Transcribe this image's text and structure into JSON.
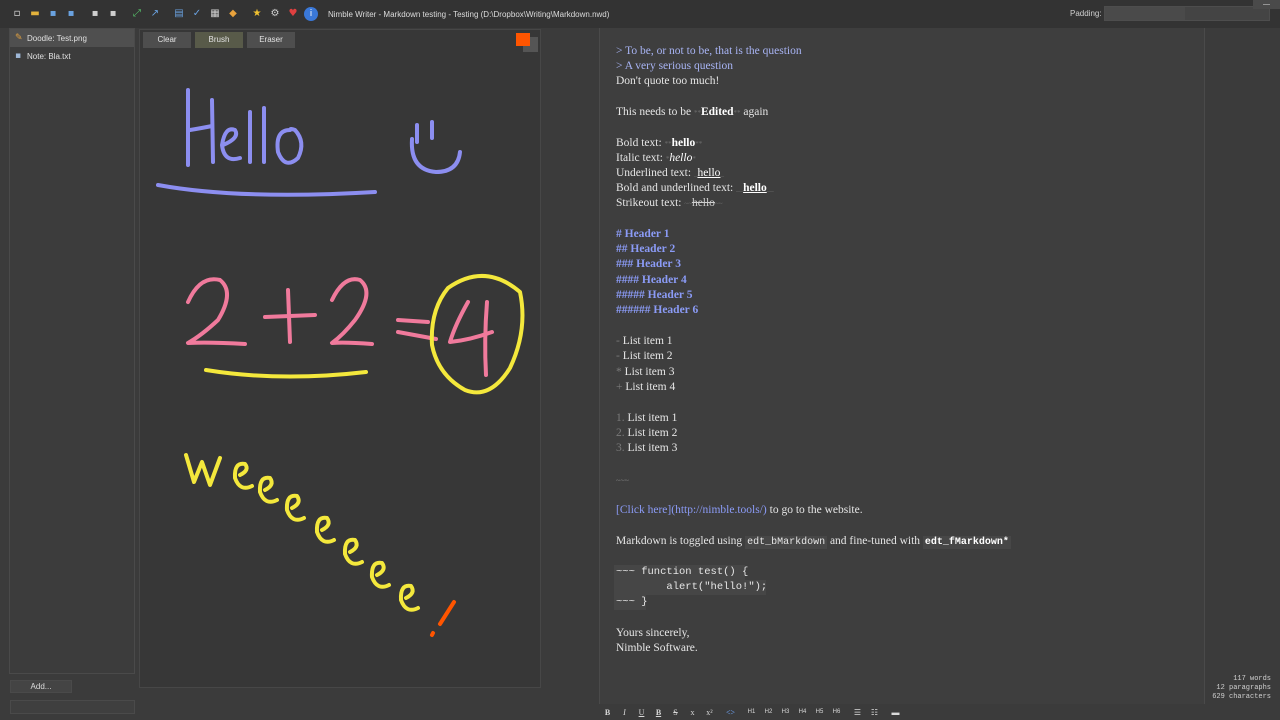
{
  "window": {
    "title": "Nimble Writer - Markdown testing - Testing (D:\\Dropbox\\Writing\\Markdown.nwd)",
    "padding_label": "Padding:"
  },
  "toolbar_icons": [
    {
      "name": "new-file-icon",
      "glyph": "▫",
      "color": "#e8e8e8"
    },
    {
      "name": "open-folder-icon",
      "glyph": "▬",
      "color": "#e3b23c"
    },
    {
      "name": "save-icon",
      "glyph": "▪",
      "color": "#6aa2e0"
    },
    {
      "name": "save-all-icon",
      "glyph": "▪",
      "color": "#6aa2e0"
    },
    {
      "name": "add-document-icon",
      "glyph": "▪",
      "color": "#cfcfcf"
    },
    {
      "name": "remove-document-icon",
      "glyph": "▪",
      "color": "#cfcfcf"
    },
    {
      "name": "fullscreen-icon",
      "glyph": "⤢",
      "color": "#57c26a"
    },
    {
      "name": "sort-icon",
      "glyph": "↗",
      "color": "#6aa2e0"
    },
    {
      "name": "book-icon",
      "glyph": "▤",
      "color": "#6aa2e0"
    },
    {
      "name": "spellcheck-icon",
      "glyph": "✓",
      "color": "#6aa2e0"
    },
    {
      "name": "document-properties-icon",
      "glyph": "▦",
      "color": "#d0d0d0"
    },
    {
      "name": "tag-icon",
      "glyph": "◆",
      "color": "#e8a23c"
    },
    {
      "name": "star-icon",
      "glyph": "★",
      "color": "#f2c230"
    },
    {
      "name": "settings-gear-icon",
      "glyph": "⚙",
      "color": "#d0d0d0"
    },
    {
      "name": "heart-icon",
      "glyph": "♥",
      "color": "#e04040"
    },
    {
      "name": "info-icon",
      "glyph": "i",
      "color": "#ffffff"
    }
  ],
  "files": [
    {
      "label": "Doodle: Test.png",
      "icon": "brush-icon",
      "selected": true
    },
    {
      "label": "Note: Bla.txt",
      "icon": "note-icon",
      "selected": false
    }
  ],
  "add_button": "Add...",
  "doodle": {
    "buttons": [
      "Clear",
      "Brush",
      "Eraser"
    ],
    "active_button": "Brush",
    "current_color": "#ff5500",
    "stroke_colors": {
      "hello": "#8c8ef0",
      "math": "#f07a9c",
      "answer": "#f4e83c",
      "exclaim": "#ff5500"
    }
  },
  "editor": {
    "quote1": "> To be, or not to be, that is the question",
    "quote2": "> A very serious question",
    "plain1": "Don't quote too much!",
    "edited_pre": "This needs to be ",
    "edited_mark": "**",
    "edited_word": "Edited",
    "edited_post": " again",
    "bold_label": "Bold text: ",
    "bold_mark": "**",
    "hello": "hello",
    "italic_label": "Italic text: ",
    "italic_mark": "*",
    "underline_label": "Underlined text: ",
    "underline_mark": "_",
    "boldunder_label": "Bold and underlined text: ",
    "boldunder_mark": "__",
    "strike_label": "Strikeout text: ",
    "strike_mark": "~~",
    "headers": [
      "# Header 1",
      "## Header 2",
      "### Header 3",
      "#### Header 4",
      "##### Header 5",
      "###### Header 6"
    ],
    "bullets": [
      {
        "mark": "-",
        "text": "List item 1"
      },
      {
        "mark": "-",
        "text": "List item 2"
      },
      {
        "mark": "*",
        "text": "List item 3"
      },
      {
        "mark": "+",
        "text": "List item 4"
      }
    ],
    "numbered": [
      {
        "mark": "1.",
        "text": "List item 1"
      },
      {
        "mark": "2.",
        "text": "List item 2"
      },
      {
        "mark": "3.",
        "text": "List item 3"
      }
    ],
    "hr": "~~~",
    "link_text": "[Click here](http://nimble.tools/)",
    "link_after": " to go to the website.",
    "toggle_pre": "Markdown is toggled using ",
    "toggle_code1": "edt_bMarkdown",
    "toggle_mid": " and fine-tuned with ",
    "toggle_code2": "edt_fMarkdown*",
    "code_lines": [
      "~~~ function test() {",
      "        alert(\"hello!\");",
      "~~~ }"
    ],
    "closing1": "Yours sincerely,",
    "closing2": "Nimble Software."
  },
  "stats": {
    "words": "117 words",
    "paragraphs": "12 paragraphs",
    "characters": "629 characters"
  },
  "format_buttons": [
    {
      "name": "bold-button",
      "label": "B"
    },
    {
      "name": "italic-button",
      "label": "I"
    },
    {
      "name": "underline-button",
      "label": "U"
    },
    {
      "name": "bold-underline-button",
      "label": "B"
    },
    {
      "name": "strikeout-button",
      "label": "S"
    },
    {
      "name": "subscript-button",
      "label": "x"
    },
    {
      "name": "superscript-button",
      "label": "x²"
    },
    {
      "name": "code-button",
      "label": "<>"
    },
    {
      "name": "h1-button",
      "label": "H1"
    },
    {
      "name": "h2-button",
      "label": "H2"
    },
    {
      "name": "h3-button",
      "label": "H3"
    },
    {
      "name": "h4-button",
      "label": "H4"
    },
    {
      "name": "h5-button",
      "label": "H5"
    },
    {
      "name": "h6-button",
      "label": "H6"
    },
    {
      "name": "bullet-list-button",
      "label": "☰"
    },
    {
      "name": "numbered-list-button",
      "label": "☷"
    },
    {
      "name": "horizontal-rule-button",
      "label": "▬"
    }
  ]
}
